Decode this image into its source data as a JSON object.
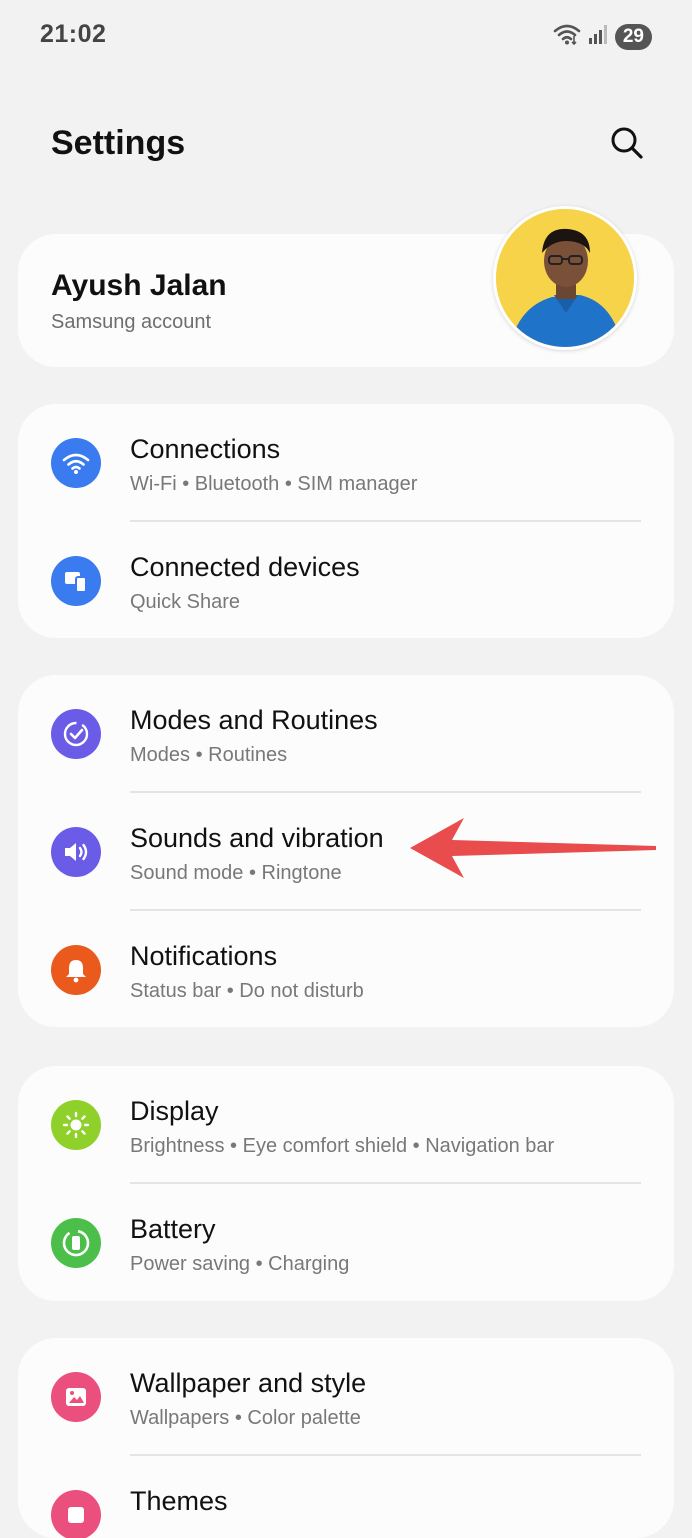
{
  "status_bar": {
    "time": "21:02",
    "battery": "29",
    "icons": [
      "wifi-icon",
      "signal-icon",
      "battery-icon"
    ]
  },
  "header": {
    "title": "Settings",
    "search_icon": "search-icon"
  },
  "account": {
    "name": "Ayush Jalan",
    "subtitle": "Samsung account"
  },
  "groups": [
    {
      "items": [
        {
          "title": "Connections",
          "subtitle": "Wi-Fi  •  Bluetooth  •  SIM manager",
          "icon": "wifi-icon",
          "color": "#3a7bf0"
        },
        {
          "title": "Connected devices",
          "subtitle": "Quick Share",
          "icon": "devices-icon",
          "color": "#3a7bf0"
        }
      ]
    },
    {
      "items": [
        {
          "title": "Modes and Routines",
          "subtitle": "Modes  •  Routines",
          "icon": "check-circle-icon",
          "color": "#6b5ce7"
        },
        {
          "title": "Sounds and vibration",
          "subtitle": "Sound mode  •  Ringtone",
          "icon": "speaker-icon",
          "color": "#6b5ce7"
        },
        {
          "title": "Notifications",
          "subtitle": "Status bar  •  Do not disturb",
          "icon": "bell-icon",
          "color": "#ea5a1c"
        }
      ]
    },
    {
      "items": [
        {
          "title": "Display",
          "subtitle": "Brightness  •  Eye comfort shield  •  Navigation bar",
          "icon": "sun-icon",
          "color": "#8fd02a"
        },
        {
          "title": "Battery",
          "subtitle": "Power saving  •  Charging",
          "icon": "battery-icon",
          "color": "#4cbf4a"
        }
      ]
    },
    {
      "items": [
        {
          "title": "Wallpaper and style",
          "subtitle": "Wallpapers  •  Color palette",
          "icon": "image-icon",
          "color": "#ea4f7e"
        },
        {
          "title": "Themes",
          "subtitle": "",
          "icon": "themes-icon",
          "color": "#ea4f7e"
        }
      ]
    }
  ],
  "annotation": {
    "arrow_color": "#e84c4c",
    "points_to": "Sounds and vibration"
  }
}
